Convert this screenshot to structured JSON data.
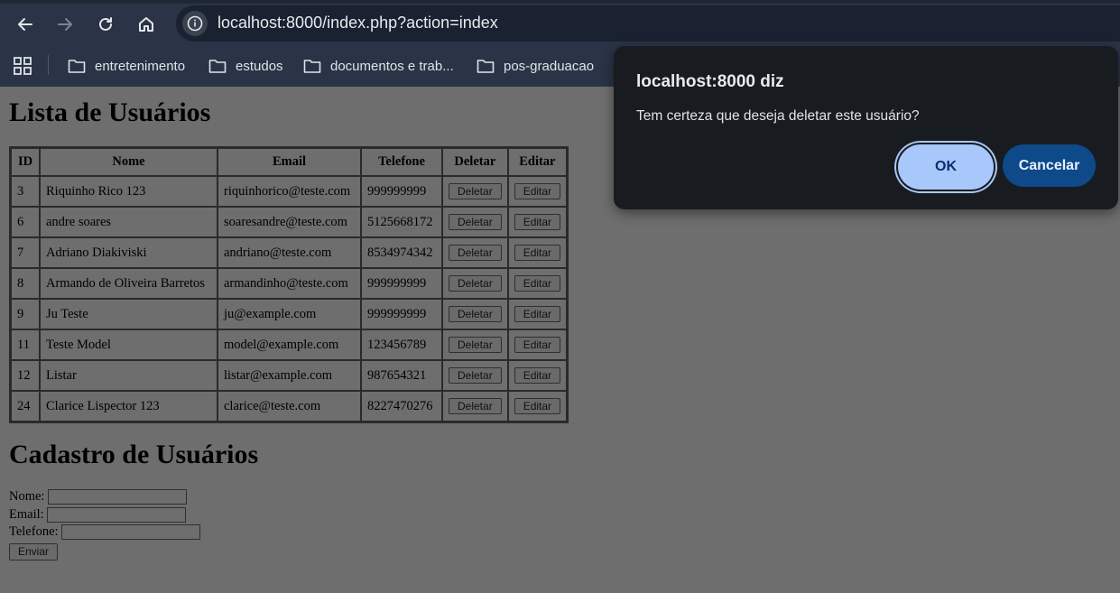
{
  "browser": {
    "url": "localhost:8000/index.php?action=index",
    "bookmarks": [
      "entretenimento",
      "estudos",
      "documentos e trab...",
      "pos-graduacao"
    ]
  },
  "page": {
    "list_title": "Lista de Usuários",
    "table": {
      "headers": [
        "ID",
        "Nome",
        "Email",
        "Telefone",
        "Deletar",
        "Editar"
      ],
      "rows": [
        {
          "id": "3",
          "nome": "Riquinho Rico 123",
          "email": "riquinhorico@teste.com",
          "telefone": "999999999"
        },
        {
          "id": "6",
          "nome": "andre soares",
          "email": "soaresandre@teste.com",
          "telefone": "5125668172"
        },
        {
          "id": "7",
          "nome": "Adriano Diakiviski",
          "email": "andriano@teste.com",
          "telefone": "8534974342"
        },
        {
          "id": "8",
          "nome": "Armando de Oliveira Barretos",
          "email": "armandinho@teste.com",
          "telefone": "999999999"
        },
        {
          "id": "9",
          "nome": "Ju Teste",
          "email": "ju@example.com",
          "telefone": "999999999"
        },
        {
          "id": "11",
          "nome": "Teste Model",
          "email": "model@example.com",
          "telefone": "123456789"
        },
        {
          "id": "12",
          "nome": "Listar",
          "email": "listar@example.com",
          "telefone": "987654321"
        },
        {
          "id": "24",
          "nome": "Clarice Lispector 123",
          "email": "clarice@teste.com",
          "telefone": "8227470276"
        }
      ],
      "delete_label": "Deletar",
      "edit_label": "Editar"
    },
    "form_title": "Cadastro de Usuários",
    "form": {
      "nome_label": "Nome:",
      "email_label": "Email:",
      "telefone_label": "Telefone:",
      "submit_label": "Enviar"
    }
  },
  "dialog": {
    "title": "localhost:8000 diz",
    "message": "Tem certeza que deseja deletar este usuário?",
    "ok_label": "OK",
    "cancel_label": "Cancelar"
  }
}
